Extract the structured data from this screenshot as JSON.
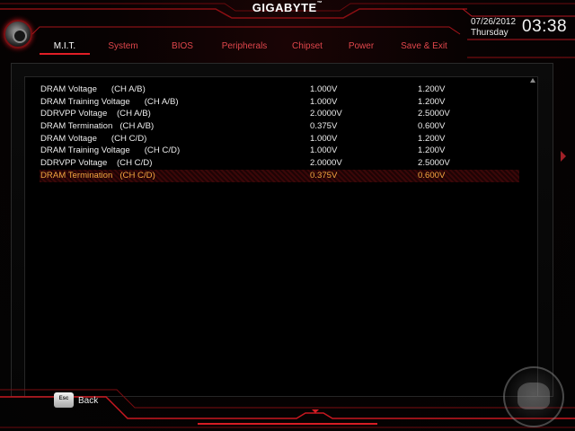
{
  "header": {
    "brand": "GIGABYTE",
    "brand_tm": "™",
    "date": "07/26/2012",
    "day": "Thursday",
    "time": "03:38"
  },
  "tabs": [
    {
      "label": "M.I.T.",
      "active": true
    },
    {
      "label": "System",
      "active": false
    },
    {
      "label": "BIOS",
      "active": false
    },
    {
      "label": "Peripherals",
      "active": false
    },
    {
      "label": "Chipset",
      "active": false
    },
    {
      "label": "Power",
      "active": false
    },
    {
      "label": "Save & Exit",
      "active": false
    }
  ],
  "settings": [
    {
      "name": "DRAM Voltage      (CH A/B)",
      "current": "1.000V",
      "default": "1.200V",
      "selected": false
    },
    {
      "name": "DRAM Training Voltage      (CH A/B)",
      "current": "1.000V",
      "default": "1.200V",
      "selected": false
    },
    {
      "name": "DDRVPP Voltage    (CH A/B)",
      "current": "2.0000V",
      "default": "2.5000V",
      "selected": false
    },
    {
      "name": "DRAM Termination   (CH A/B)",
      "current": "0.375V",
      "default": "0.600V",
      "selected": false
    },
    {
      "name": "DRAM Voltage      (CH C/D)",
      "current": "1.000V",
      "default": "1.200V",
      "selected": false
    },
    {
      "name": "DRAM Training Voltage      (CH C/D)",
      "current": "1.000V",
      "default": "1.200V",
      "selected": false
    },
    {
      "name": "DDRVPP Voltage    (CH C/D)",
      "current": "2.0000V",
      "default": "2.5000V",
      "selected": false
    },
    {
      "name": "DRAM Termination   (CH C/D)",
      "current": "0.375V",
      "default": "0.600V",
      "selected": true
    }
  ],
  "footer": {
    "esc_key": "Esc",
    "back_label": "Back"
  },
  "colors": {
    "accent_red": "#d61d24",
    "selected_text": "#f2a640",
    "tab_inactive": "#e0464b"
  }
}
